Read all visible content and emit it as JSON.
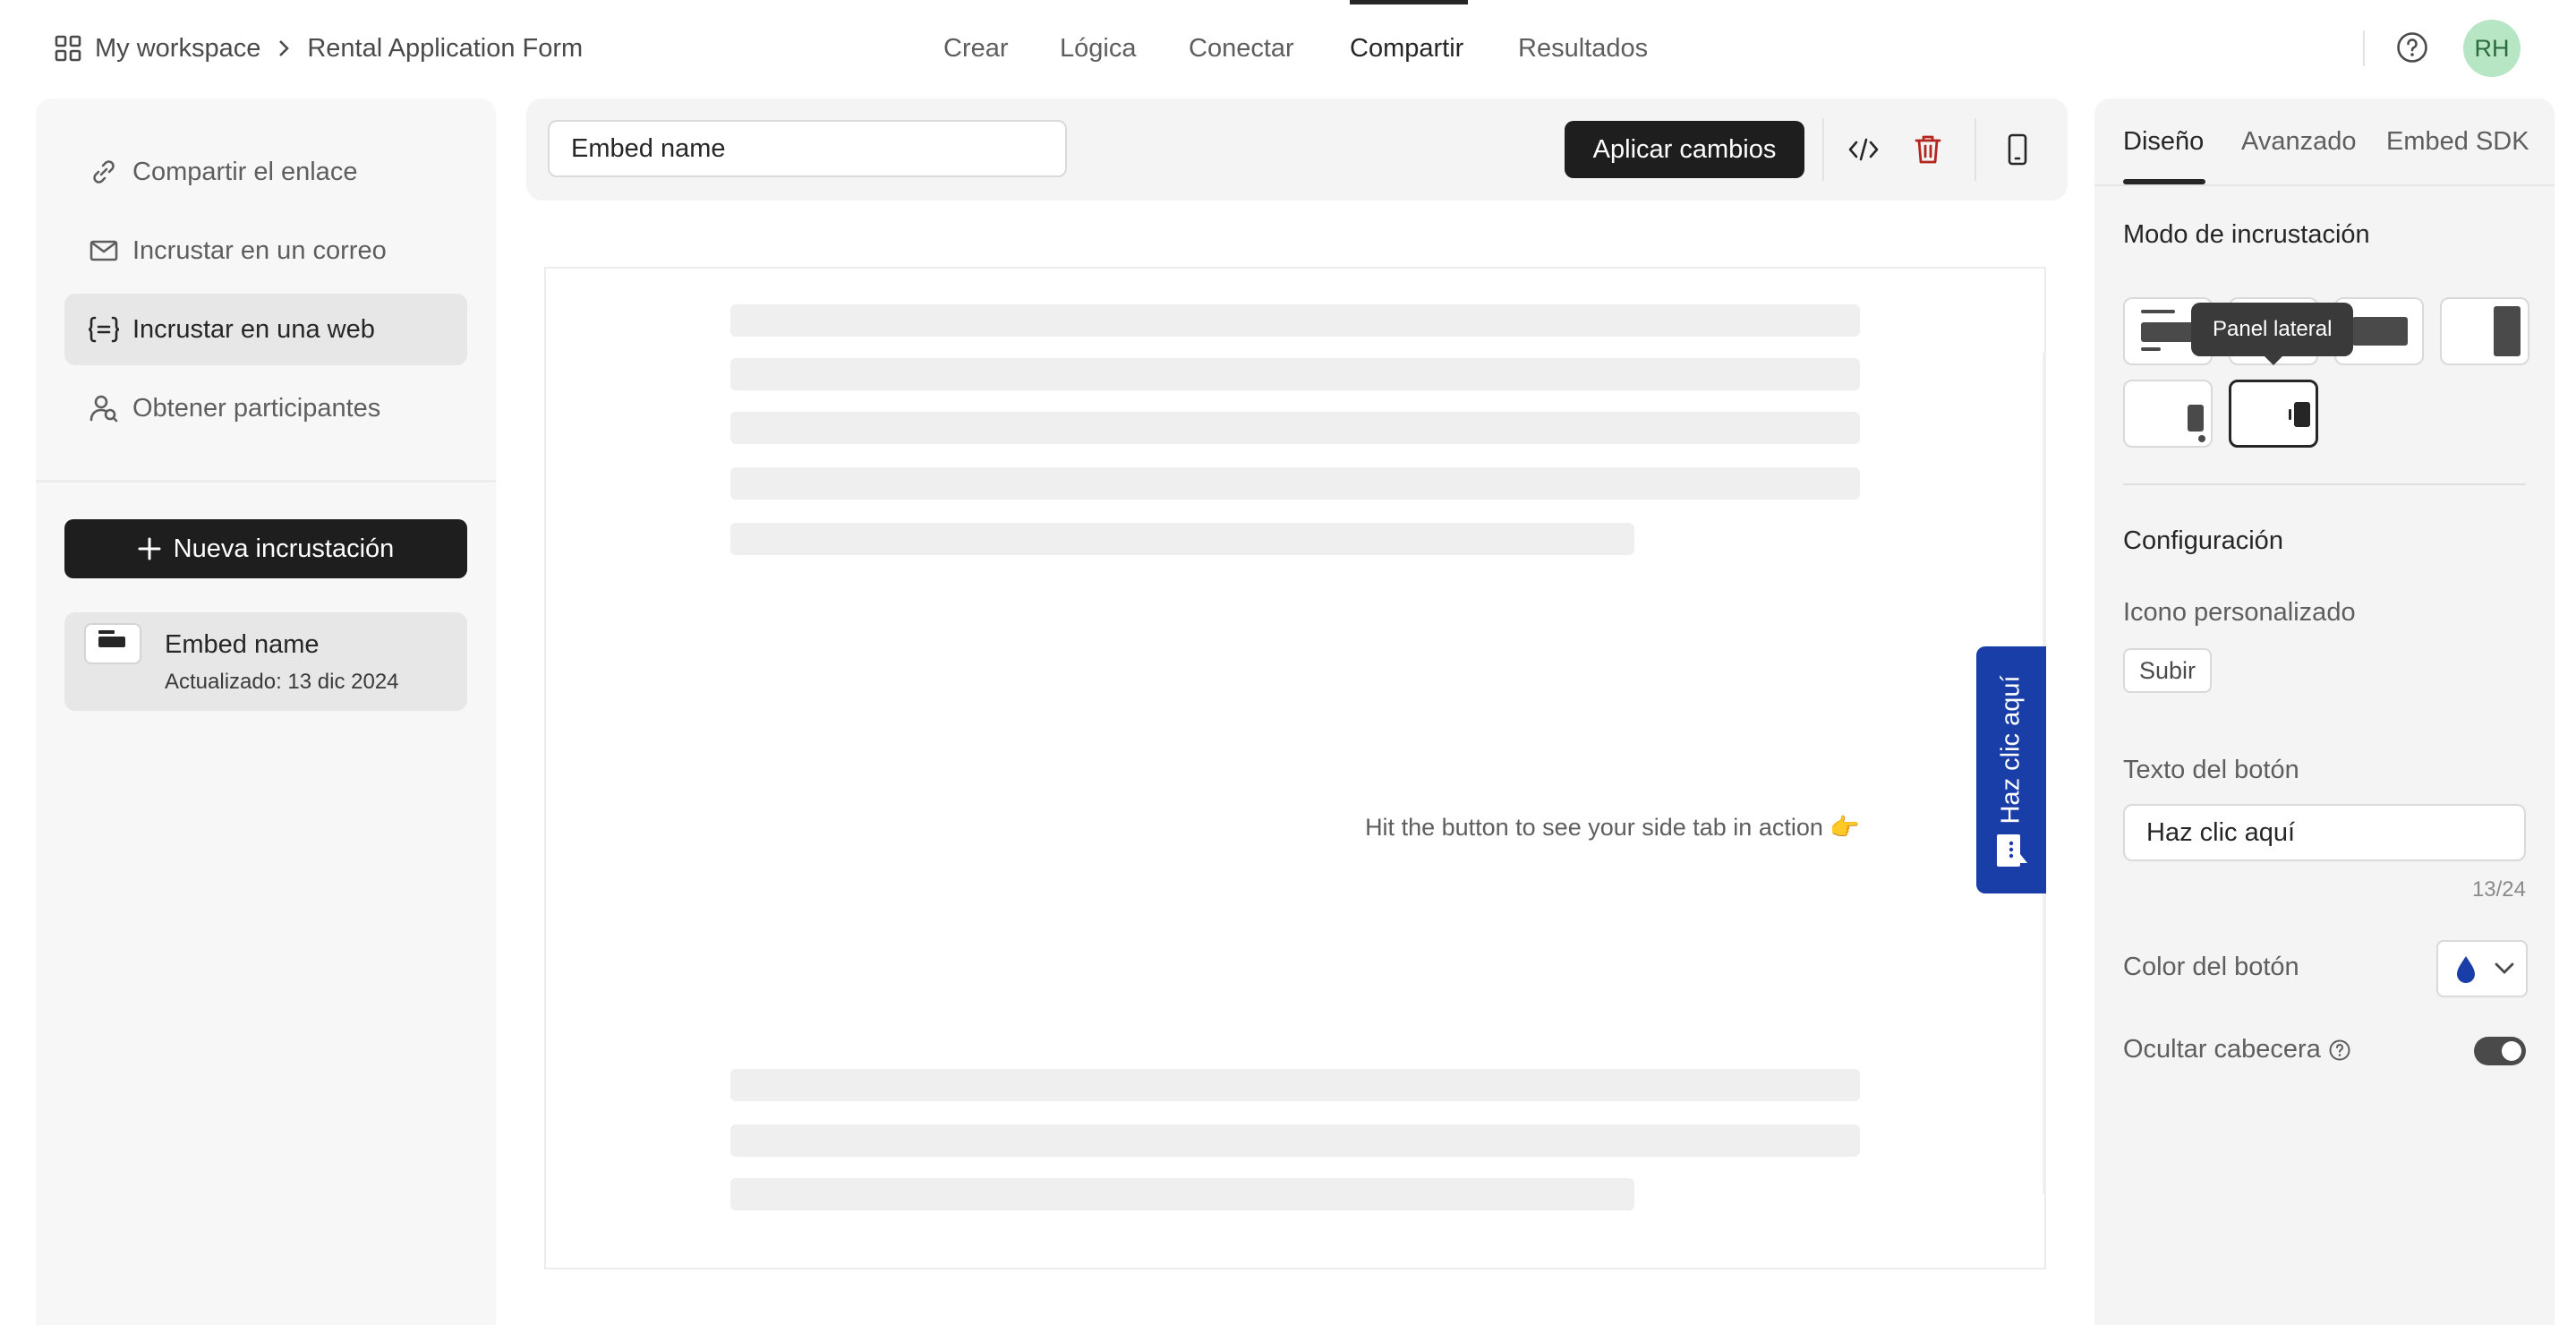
{
  "breadcrumb": {
    "workspace": "My workspace",
    "form": "Rental Application Form"
  },
  "nav": {
    "tabs": [
      "Crear",
      "Lógica",
      "Conectar",
      "Compartir",
      "Resultados"
    ],
    "active": "Compartir"
  },
  "user": {
    "initials": "RH"
  },
  "sidebar": {
    "items": [
      {
        "label": "Compartir el enlace",
        "icon": "link-icon"
      },
      {
        "label": "Incrustar en un correo",
        "icon": "mail-icon"
      },
      {
        "label": "Incrustar en una web",
        "icon": "code-braces-icon",
        "active": true
      },
      {
        "label": "Obtener participantes",
        "icon": "user-search-icon"
      }
    ],
    "new_button": "Nueva incrustación",
    "embed": {
      "name": "Embed name",
      "updated": "Actualizado: 13 dic 2024"
    }
  },
  "toolbar": {
    "name_value": "Embed name",
    "apply_label": "Aplicar cambios"
  },
  "preview": {
    "message": "Hit the button to see your side tab in action 👉",
    "side_tab_label": "Haz clic aquí",
    "side_tab_color": "#1a3ea8"
  },
  "right_panel": {
    "tabs": [
      "Diseño",
      "Avanzado",
      "Embed SDK"
    ],
    "active_tab": "Diseño",
    "mode_heading": "Modo de incrustación",
    "tooltip": "Panel lateral",
    "config_heading": "Configuración",
    "custom_icon_label": "Icono personalizado",
    "upload_label": "Subir",
    "button_text_label": "Texto del botón",
    "button_text_value": "Haz clic aquí",
    "char_count": "13/24",
    "button_color_label": "Color del botón",
    "button_color": "#1a3ea8",
    "hide_header_label": "Ocultar cabecera",
    "hide_header_on": true
  }
}
